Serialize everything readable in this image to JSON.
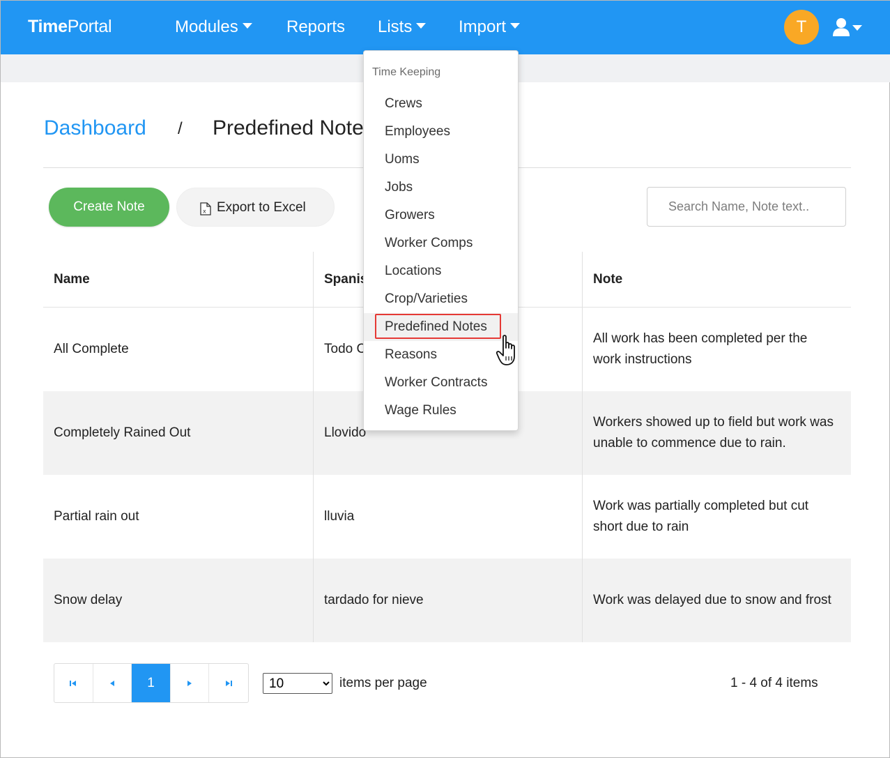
{
  "navbar": {
    "brand_part1": "Time",
    "brand_part2": "Portal",
    "menu": [
      {
        "label": "Modules",
        "has_dropdown": true
      },
      {
        "label": "Reports",
        "has_dropdown": false
      },
      {
        "label": "Lists",
        "has_dropdown": true
      },
      {
        "label": "Import",
        "has_dropdown": true
      }
    ],
    "avatar_letter": "T",
    "user_icon": "user-icon",
    "color": "#2196f3"
  },
  "breadcrumb": {
    "link": "Dashboard",
    "separator": "/",
    "current": "Predefined Notes"
  },
  "toolbar": {
    "create_label": "Create Note",
    "export_label": "Export to Excel",
    "export_icon": "excel-file-icon",
    "search_placeholder": "Search Name, Note text.."
  },
  "grid": {
    "columns": [
      "Name",
      "Spanish",
      "Note"
    ],
    "rows": [
      {
        "name": "All Complete",
        "spanish": "Todo Completo",
        "note": "All work has been completed per the work instructions"
      },
      {
        "name": "Completely Rained Out",
        "spanish": "Llovido",
        "note": "Workers showed up to field but work was unable to commence due to rain."
      },
      {
        "name": "Partial rain out",
        "spanish": "lluvia",
        "note": "Work was partially completed but cut short due to rain"
      },
      {
        "name": "Snow delay",
        "spanish": "tardado for nieve",
        "note": "Work was delayed due to snow and frost"
      }
    ]
  },
  "pager": {
    "current_page": "1",
    "page_size": "10",
    "page_size_options": [
      "10"
    ],
    "items_per_page_label": "items per page",
    "range_label": "1 - 4 of 4 items"
  },
  "dropdown": {
    "header": "Time Keeping",
    "items": [
      "Crews",
      "Employees",
      "Uoms",
      "Jobs",
      "Growers",
      "Worker Comps",
      "Locations",
      "Crop/Varieties",
      "Predefined Notes",
      "Reasons",
      "Worker Contracts",
      "Wage Rules"
    ],
    "highlighted_item": "Predefined Notes",
    "highlight_color": "#e53935"
  },
  "colors": {
    "primary": "#2196f3",
    "create_button": "#5cb85c",
    "avatar": "#f9a825",
    "row_alt": "#f2f2f2"
  }
}
